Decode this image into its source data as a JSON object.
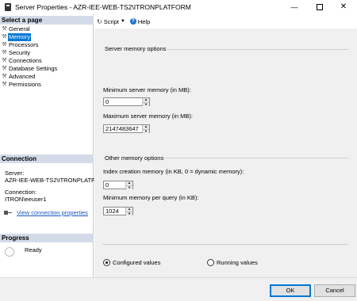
{
  "window": {
    "title": "Server Properties - AZR-IEE-WEB-TS2\\ITRONPLATFORM",
    "minimize": "—",
    "close": "✕"
  },
  "left": {
    "select_page_header": "Select a page",
    "pages": [
      {
        "label": "General",
        "selected": false
      },
      {
        "label": "Memory",
        "selected": true
      },
      {
        "label": "Processors",
        "selected": false
      },
      {
        "label": "Security",
        "selected": false
      },
      {
        "label": "Connections",
        "selected": false
      },
      {
        "label": "Database Settings",
        "selected": false
      },
      {
        "label": "Advanced",
        "selected": false
      },
      {
        "label": "Permissions",
        "selected": false
      }
    ],
    "connection_header": "Connection",
    "server_label": "Server:",
    "server_value": "AZR-IEE-WEB-TS2\\ITRONPLATF",
    "connection_label": "Connection:",
    "connection_value": "ITRON\\eeuser1",
    "view_connection_properties": "View connection properties",
    "progress_header": "Progress",
    "progress_status": "Ready"
  },
  "toolbar": {
    "script_label": "Script",
    "help_label": "Help"
  },
  "server_memory": {
    "title": "Server memory options",
    "min_label": "Minimum server memory (in MB):",
    "min_value": "0",
    "max_label": "Maximum server memory (in MB):",
    "max_value": "2147483647"
  },
  "other_memory": {
    "title": "Other memory options",
    "index_label": "Index creation memory (in KB, 0 = dynamic memory):",
    "index_value": "0",
    "min_query_label": "Minimum memory per query (in KB):",
    "min_query_value": "1024"
  },
  "values_mode": {
    "configured_label": "Configured values",
    "running_label": "Running values",
    "selected": "configured"
  },
  "buttons": {
    "ok": "OK",
    "cancel": "Cancel"
  }
}
